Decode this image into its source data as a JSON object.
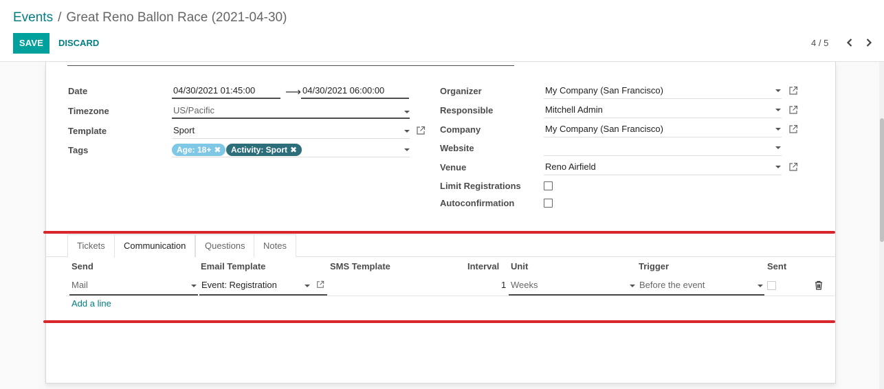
{
  "breadcrumb": {
    "parent": "Events",
    "separator": "/",
    "current": "Great Reno Ballon Race (2021-04-30)"
  },
  "toolbar": {
    "save_label": "SAVE",
    "discard_label": "DISCARD"
  },
  "pager": {
    "value": "4 / 5"
  },
  "form": {
    "date": {
      "label": "Date",
      "start": "04/30/2021 01:45:00",
      "end": "04/30/2021 06:00:00"
    },
    "timezone": {
      "label": "Timezone",
      "value": "US/Pacific"
    },
    "template": {
      "label": "Template",
      "value": "Sport"
    },
    "tags": {
      "label": "Tags",
      "items": [
        {
          "label": "Age: 18+",
          "color": "#7ec7e5"
        },
        {
          "label": "Activity: Sport",
          "color": "#2c6e7a"
        }
      ]
    },
    "organizer": {
      "label": "Organizer",
      "value": "My Company (San Francisco)"
    },
    "responsible": {
      "label": "Responsible",
      "value": "Mitchell Admin"
    },
    "company": {
      "label": "Company",
      "value": "My Company (San Francisco)"
    },
    "website": {
      "label": "Website",
      "value": ""
    },
    "venue": {
      "label": "Venue",
      "value": "Reno Airfield"
    },
    "limit_registrations": {
      "label": "Limit Registrations",
      "checked": false
    },
    "autoconfirmation": {
      "label": "Autoconfirmation",
      "checked": false
    }
  },
  "tabs": [
    {
      "label": "Tickets",
      "active": false
    },
    {
      "label": "Communication",
      "active": true
    },
    {
      "label": "Questions",
      "active": false
    },
    {
      "label": "Notes",
      "active": false
    }
  ],
  "communication_table": {
    "headers": {
      "send": "Send",
      "email_template": "Email Template",
      "sms_template": "SMS Template",
      "interval": "Interval",
      "unit": "Unit",
      "trigger": "Trigger",
      "sent": "Sent"
    },
    "rows": [
      {
        "send": "Mail",
        "email_template": "Event: Registration",
        "sms_template": "",
        "interval": "1",
        "unit": "Weeks",
        "trigger": "Before the event",
        "sent": false
      }
    ],
    "add_line_label": "Add a line"
  },
  "colors": {
    "accent": "#00a09d",
    "link": "#017e84",
    "annotation": "#d9262c"
  }
}
